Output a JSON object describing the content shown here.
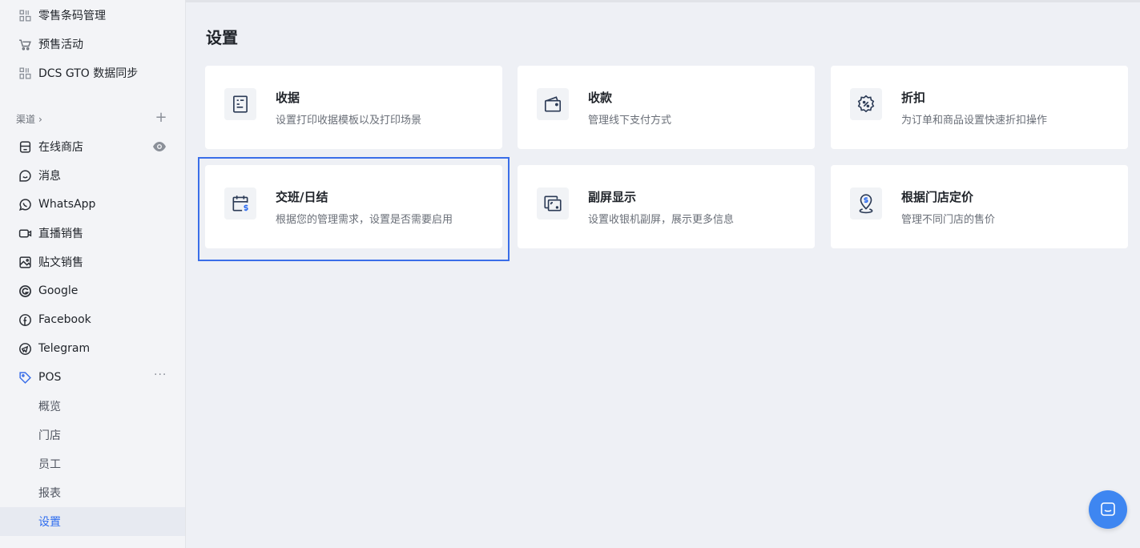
{
  "sidebar": {
    "top_items": [
      {
        "label": "零售条码管理",
        "icon": "grid-icon"
      },
      {
        "label": "预售活动",
        "icon": "cart-tag-icon"
      },
      {
        "label": "DCS GTO 数据同步",
        "icon": "grid-icon"
      }
    ],
    "channel_group": {
      "label": "渠道",
      "chevron": "›",
      "add": "+"
    },
    "channels": [
      {
        "label": "在线商店",
        "icon": "store-icon"
      },
      {
        "label": "消息",
        "icon": "chat-icon"
      },
      {
        "label": "WhatsApp",
        "icon": "whatsapp-icon"
      },
      {
        "label": "直播销售",
        "icon": "live-video-icon"
      },
      {
        "label": "贴文销售",
        "icon": "image-post-icon"
      },
      {
        "label": "Google",
        "icon": "google-icon"
      },
      {
        "label": "Facebook",
        "icon": "facebook-icon"
      },
      {
        "label": "Telegram",
        "icon": "telegram-icon"
      },
      {
        "label": "POS",
        "icon": "tag-icon"
      }
    ],
    "pos_more": "···",
    "pos_sub": [
      {
        "label": "概览"
      },
      {
        "label": "门店"
      },
      {
        "label": "员工"
      },
      {
        "label": "报表"
      },
      {
        "label": "设置",
        "active": true
      }
    ]
  },
  "main": {
    "title": "设置",
    "cards": [
      {
        "title": "收据",
        "desc": "设置打印收据模板以及打印场景",
        "icon": "receipt-icon"
      },
      {
        "title": "收款",
        "desc": "管理线下支付方式",
        "icon": "wallet-icon"
      },
      {
        "title": "折扣",
        "desc": "为订单和商品设置快速折扣操作",
        "icon": "discount-badge-icon"
      },
      {
        "title": "交班/日结",
        "desc": "根据您的管理需求，设置是否需要启用",
        "icon": "calendar-dollar-icon",
        "selected": true
      },
      {
        "title": "副屏显示",
        "desc": "设置收银机副屏，展示更多信息",
        "icon": "second-screen-icon"
      },
      {
        "title": "根据门店定价",
        "desc": "管理不同门店的售价",
        "icon": "location-dollar-icon"
      }
    ]
  },
  "colors": {
    "accent": "#2f6df0",
    "highlight_border": "#3a6ee8",
    "chat_button": "#3e86f1",
    "icon_stroke": "#2b3a55"
  }
}
